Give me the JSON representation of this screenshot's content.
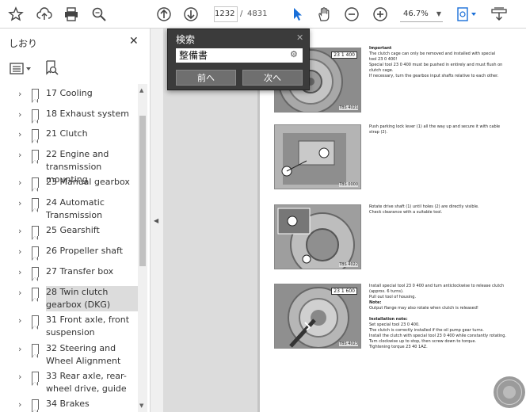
{
  "toolbar": {
    "icons": [
      "star-icon",
      "upload-icon",
      "print-icon",
      "zoom-search-icon",
      "arrow-up-icon",
      "arrow-down-icon",
      "cursor-icon",
      "hand-icon",
      "zoom-out-icon",
      "zoom-in-icon",
      "page-view-icon",
      "download-tray-icon"
    ],
    "page_current": "1232",
    "page_sep": "/",
    "page_total": "4831",
    "zoom": "46.7%"
  },
  "sidebar": {
    "title": "しおり",
    "items": [
      {
        "label": "17 Cooling"
      },
      {
        "label": "18 Exhaust system"
      },
      {
        "label": "21 Clutch"
      },
      {
        "label": "22 Engine and transmission mounting"
      },
      {
        "label": "23 Manual gearbox"
      },
      {
        "label": "24 Automatic Transmission"
      },
      {
        "label": "25 Gearshift"
      },
      {
        "label": "26 Propeller shaft"
      },
      {
        "label": "27 Transfer box"
      },
      {
        "label": "28 Twin clutch gearbox (DKG)"
      },
      {
        "label": "31 Front axle, front suspension"
      },
      {
        "label": "32 Steering and Wheel Alignment"
      },
      {
        "label": "33 Rear axle, rear-wheel drive, guide"
      },
      {
        "label": "34 Brakes"
      }
    ]
  },
  "find": {
    "title": "検索",
    "query": "整備書",
    "prev_label": "前へ",
    "next_label": "次へ"
  },
  "document": {
    "figures": [
      {
        "tag": "23 1 400",
        "code": "TBS 4021"
      },
      {
        "tag": "",
        "code": "TBS 0000"
      },
      {
        "tag": "",
        "code": "TBS 4022"
      },
      {
        "tag": "23 1 600",
        "code": "TBS 4023"
      }
    ],
    "texts": [
      {
        "heading": "Important",
        "lines": [
          "The clutch cage can only be removed and installed with special",
          "tool 23 0 400!",
          "Special tool 23 0 400 must be pushed in entirely and must flush on",
          "clutch cage.",
          "If necessary, turn the gearbox input shafts relative to each other."
        ]
      },
      {
        "heading": "",
        "lines": [
          "Push parking lock lever (1) all the way up and secure it with cable",
          "strap (2)."
        ]
      },
      {
        "heading": "",
        "lines": [
          "Rotate drive shaft (1) until holes (2) are directly visible.",
          "Check clearance with a suitable tool."
        ]
      },
      {
        "heading": "",
        "lines": [
          "Install special tool 23 0 400 and turn anticlockwise to release clutch",
          "(approx. 6 turns).",
          "Pull out tool of housing.",
          "Note:",
          "Output flange may also rotate when clutch is released!",
          "",
          "Installation note:",
          "Set special tool 23 0 400.",
          "The clutch is correctly installed if the oil pump gear turns.",
          "Install the clutch with special tool 23 0 400 while constantly rotating.",
          "Turn clockwise up to stop, then screw down to torque.",
          "Tightening torque 23 40 1AZ."
        ]
      }
    ]
  }
}
